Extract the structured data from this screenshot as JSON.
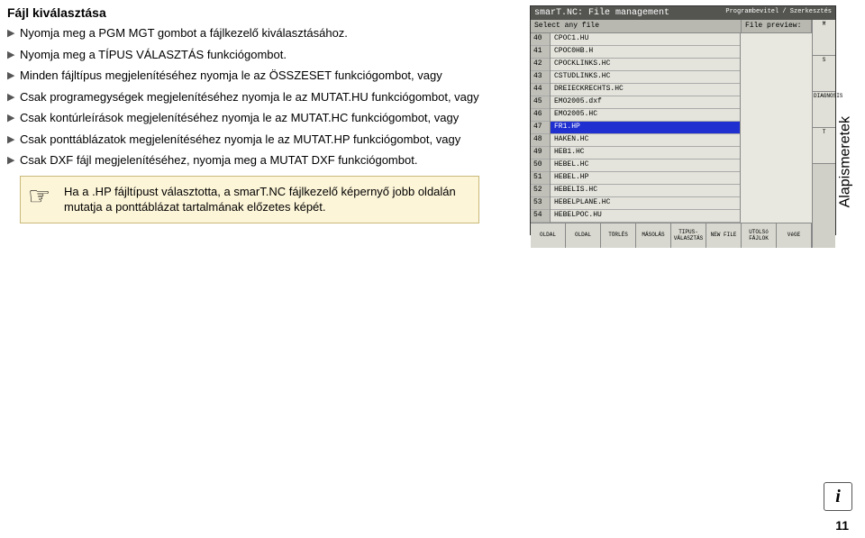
{
  "title": "Fájl kiválasztása",
  "bullets": [
    "Nyomja meg a PGM MGT gombot a fájlkezelő kiválasztásához.",
    "Nyomja meg a TÍPUS VÁLASZTÁS funkciógombot.",
    "Minden fájltípus megjelenítéséhez nyomja le az ÖSSZESET funkciógombot, vagy",
    "Csak programegységek megjelenítéséhez nyomja le az MUTAT.HU funkciógombot, vagy",
    "Csak kontúrleírások megjelenítéséhez nyomja le az MUTAT.HC funkciógombot, vagy",
    "Csak ponttáblázatok megjelenítéséhez nyomja le az MUTAT.HP funkciógombot, vagy",
    "Csak DXF fájl megjelenítéséhez, nyomja meg a MUTAT DXF funkciógombot."
  ],
  "note": "Ha a .HP fájltípust választotta, a smarT.NC fájlkezelő képernyő jobb oldalán mutatja a ponttáblázat tartalmának előzetes képét.",
  "screenshot": {
    "title_left": "smarT.NC: File management",
    "title_right": "Programbevitel / Szerkesztés",
    "select_label": "Select any file",
    "preview_label": "File preview:",
    "nums": [
      "40",
      "41",
      "42",
      "43",
      "44",
      "45",
      "46",
      "47",
      "48",
      "49",
      "50",
      "51",
      "52",
      "53",
      "54"
    ],
    "files": [
      "CPOC1.HU",
      "CPOC0HB.H",
      "CPOCKLINKS.HC",
      "CSTUDLINKS.HC",
      "DREIECKRECHTS.HC",
      "EMO2005.dxf",
      "EMO2005.HC",
      "FR1.HP",
      "HAKEN.HC",
      "HEB1.HC",
      "HEBEL.HC",
      "HEBEL.HP",
      "HEBELIS.HC",
      "HEBELPLANE.HC",
      "HEBELPOC.HU"
    ],
    "sel_index": 7,
    "softkeys": [
      "OLDAL",
      "OLDAL",
      "TÖRLÉS",
      "MÁSOLÁS",
      "TIPUS-VÁLASZTÁS",
      "NEW FILE",
      "UTOLSó FÁJLOK",
      "VéGE"
    ],
    "side_buttons": [
      "M",
      "S",
      "DIAGNOSIS",
      "T"
    ]
  },
  "side_label": "Alapismeretek",
  "info_glyph": "i",
  "page_number": "11"
}
